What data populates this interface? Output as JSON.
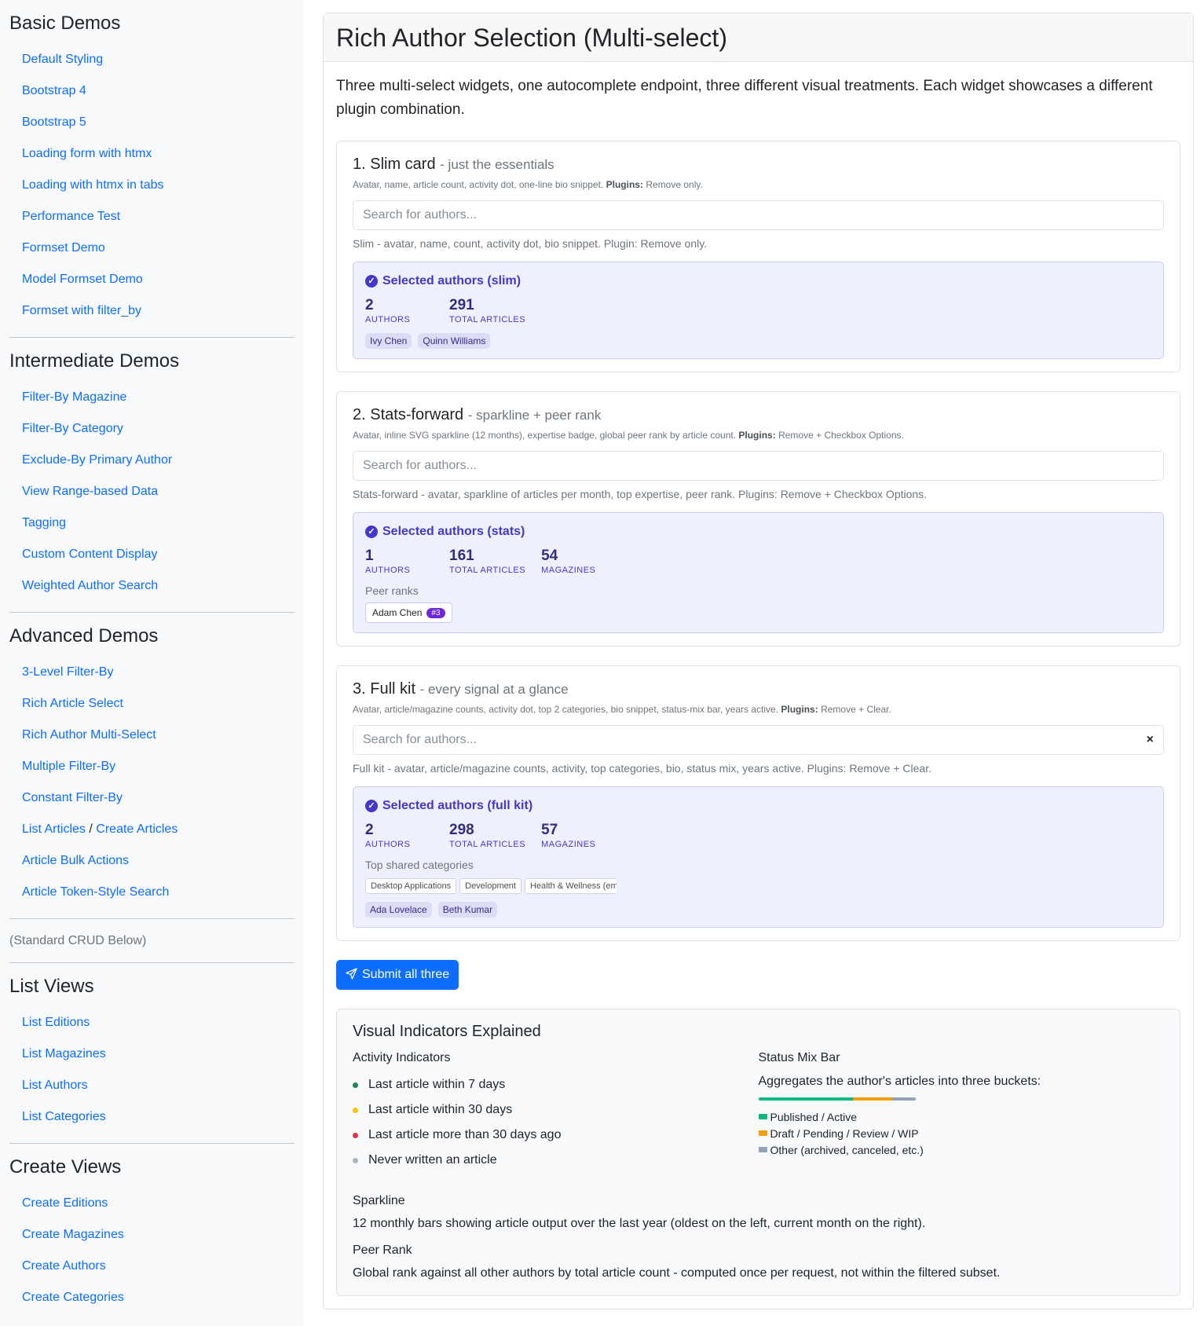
{
  "sidebar": {
    "basic": {
      "title": "Basic Demos",
      "items": [
        "Default Styling",
        "Bootstrap 4",
        "Bootstrap 5",
        "Loading form with htmx",
        "Loading with htmx in tabs",
        "Performance Test",
        "Formset Demo",
        "Model Formset Demo",
        "Formset with filter_by"
      ]
    },
    "intermediate": {
      "title": "Intermediate Demos",
      "items": [
        "Filter-By Magazine",
        "Filter-By Category",
        "Exclude-By Primary Author",
        "View Range-based Data",
        "Tagging",
        "Custom Content Display",
        "Weighted Author Search"
      ]
    },
    "advanced": {
      "title": "Advanced Demos",
      "items": [
        "3-Level Filter-By",
        "Rich Article Select",
        "Rich Author Multi-Select",
        "Multiple Filter-By",
        "Constant Filter-By"
      ],
      "list_articles": "List Articles",
      "slash": "/",
      "create_articles": "Create Articles",
      "items2": [
        "Article Bulk Actions",
        "Article Token-Style Search"
      ]
    },
    "crud_note": "(Standard CRUD Below)",
    "list_views": {
      "title": "List Views",
      "items": [
        "List Editions",
        "List Magazines",
        "List Authors",
        "List Categories"
      ]
    },
    "create_views": {
      "title": "Create Views",
      "items": [
        "Create Editions",
        "Create Magazines",
        "Create Authors",
        "Create Categories"
      ]
    }
  },
  "page": {
    "title": "Rich Author Selection (Multi-select)",
    "intro": "Three multi-select widgets, one autocomplete endpoint, three different visual treatments. Each widget showcases a different plugin combination."
  },
  "demos": [
    {
      "title": "1. Slim card",
      "subtitle": "- just the essentials",
      "desc": "Avatar, name, article count, activity dot, one-line bio snippet.",
      "plugins_label": "Plugins:",
      "plugins": "Remove only.",
      "placeholder": "Search for authors...",
      "help": "Slim - avatar, name, count, activity dot, bio snippet. Plugin: Remove only.",
      "sel_title": "Selected authors (slim)",
      "stats": [
        {
          "num": "2",
          "label": "AUTHORS"
        },
        {
          "num": "291",
          "label": "TOTAL ARTICLES"
        }
      ],
      "chips": [
        "Ivy Chen",
        "Quinn Williams"
      ]
    },
    {
      "title": "2. Stats-forward",
      "subtitle": "- sparkline + peer rank",
      "desc": "Avatar, inline SVG sparkline (12 months), expertise badge, global peer rank by article count.",
      "plugins_label": "Plugins:",
      "plugins": "Remove + Checkbox Options.",
      "placeholder": "Search for authors...",
      "help": "Stats-forward - avatar, sparkline of articles per month, top expertise, peer rank. Plugins: Remove + Checkbox Options.",
      "sel_title": "Selected authors (stats)",
      "stats": [
        {
          "num": "1",
          "label": "AUTHORS"
        },
        {
          "num": "161",
          "label": "TOTAL ARTICLES"
        },
        {
          "num": "54",
          "label": "MAGAZINES"
        }
      ],
      "peer_label": "Peer ranks",
      "peer_name": "Adam Chen",
      "peer_rank": "#3"
    },
    {
      "title": "3. Full kit",
      "subtitle": "- every signal at a glance",
      "desc": "Avatar, article/magazine counts, activity dot, top 2 categories, bio snippet, status-mix bar, years active.",
      "plugins_label": "Plugins:",
      "plugins": "Remove + Clear.",
      "placeholder": "Search for authors...",
      "clear": "×",
      "help": "Full kit - avatar, article/magazine counts, activity, top categories, bio, status mix, years active. Plugins: Remove + Clear.",
      "sel_title": "Selected authors (full kit)",
      "stats": [
        {
          "num": "2",
          "label": "AUTHORS"
        },
        {
          "num": "298",
          "label": "TOTAL ARTICLES"
        },
        {
          "num": "57",
          "label": "MAGAZINES"
        }
      ],
      "cat_label": "Top shared categories",
      "categories": [
        "Desktop Applications",
        "Development",
        "Health & Wellness (empty c"
      ],
      "chips": [
        "Ada Lovelace",
        "Beth Kumar"
      ]
    }
  ],
  "submit_label": "Submit all three",
  "legend": {
    "title": "Visual Indicators Explained",
    "activity": {
      "title": "Activity Indicators",
      "items": [
        {
          "text": "Last article within 7 days",
          "color": "#198754"
        },
        {
          "text": "Last article within 30 days",
          "color": "#ffc107"
        },
        {
          "text": "Last article more than 30 days ago",
          "color": "#dc3545"
        },
        {
          "text": "Never written an article",
          "color": "#adb5bd"
        }
      ]
    },
    "mix": {
      "title": "Status Mix Bar",
      "text": "Aggregates the author's articles into three buckets:",
      "bar": [
        {
          "fraction": 0.6,
          "color": "#10b981"
        },
        {
          "fraction": 0.25,
          "color": "#f59e0b"
        },
        {
          "fraction": 0.15,
          "color": "#94a3b8"
        }
      ],
      "items": [
        {
          "text": "Published / Active",
          "color": "#10b981"
        },
        {
          "text": "Draft / Pending / Review / WIP",
          "color": "#f59e0b"
        },
        {
          "text": "Other (archived, canceled, etc.)",
          "color": "#94a3b8"
        }
      ]
    },
    "sparkline": {
      "title": "Sparkline",
      "text": "12 monthly bars showing article output over the last year (oldest on the left, current month on the right)."
    },
    "peer": {
      "title": "Peer Rank",
      "text": "Global rank against all other authors by total article count - computed once per request, not within the filtered subset."
    }
  }
}
